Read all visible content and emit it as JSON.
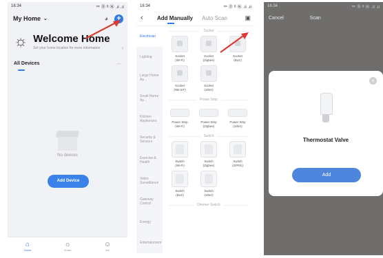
{
  "accent": "#2f7ae6",
  "arrow_color": "#d93a2f",
  "screen1": {
    "status_time": "16:34",
    "status_right": "™ Ⓓ ᴮ Ⓝ .ıl .ıl",
    "home_title": "My Home",
    "welcome_title": "Welcome Home",
    "welcome_subtitle": "Set your home location for more information",
    "devices_tab": "All Devices",
    "empty_text": "No devices",
    "add_button": "Add Device",
    "tabbar": [
      {
        "label": "Home",
        "icon": "home-icon"
      },
      {
        "label": "Smart",
        "icon": "smart-icon"
      },
      {
        "label": "Me",
        "icon": "me-icon"
      }
    ]
  },
  "screen2": {
    "status_time": "16:34",
    "status_right": "™ Ⓓ ᴮ Ⓝ .ıl .ıl",
    "tab_active": "Add Manually",
    "tab_inactive": "Auto Scan",
    "categories": [
      "Electrician",
      "Lighting",
      "Large Home Ap...",
      "Small Home Ap...",
      "Kitchen Appliances",
      "Security & Sensors",
      "Exercise & Health",
      "Video Surveillance",
      "Gateway Control",
      "Energy",
      "Entertainment"
    ],
    "sections": {
      "socket": "Socket",
      "strip": "Power Strip",
      "switch": "Switch",
      "dimmer": "Dimmer Switch"
    },
    "sockets": [
      [
        "Socket",
        "(Wi-Fi)"
      ],
      [
        "Socket",
        "(Zigbee)"
      ],
      [
        "Socket",
        "(BLE)"
      ],
      [
        "Socket",
        "(NB-IoT)"
      ],
      [
        "Socket",
        "(other)"
      ]
    ],
    "strips": [
      [
        "Power Strip",
        "(Wi-Fi)"
      ],
      [
        "Power Strip",
        "(Zigbee)"
      ],
      [
        "Power Strip",
        "(other)"
      ]
    ],
    "switches": [
      [
        "Switch",
        "(Wi-Fi)"
      ],
      [
        "Switch",
        "(Zigbee)"
      ],
      [
        "Switch",
        "(GPRS)"
      ],
      [
        "Switch",
        "(BLE)"
      ],
      [
        "Switch",
        "(other)"
      ]
    ]
  },
  "screen3": {
    "status_time": "16:34",
    "status_right": "™ Ⓓ ᴮ Ⓝ .ıl .ıl",
    "cancel": "Cancel",
    "title": "Scan",
    "device_name": "Thermostat Valve",
    "add_button": "Add"
  }
}
